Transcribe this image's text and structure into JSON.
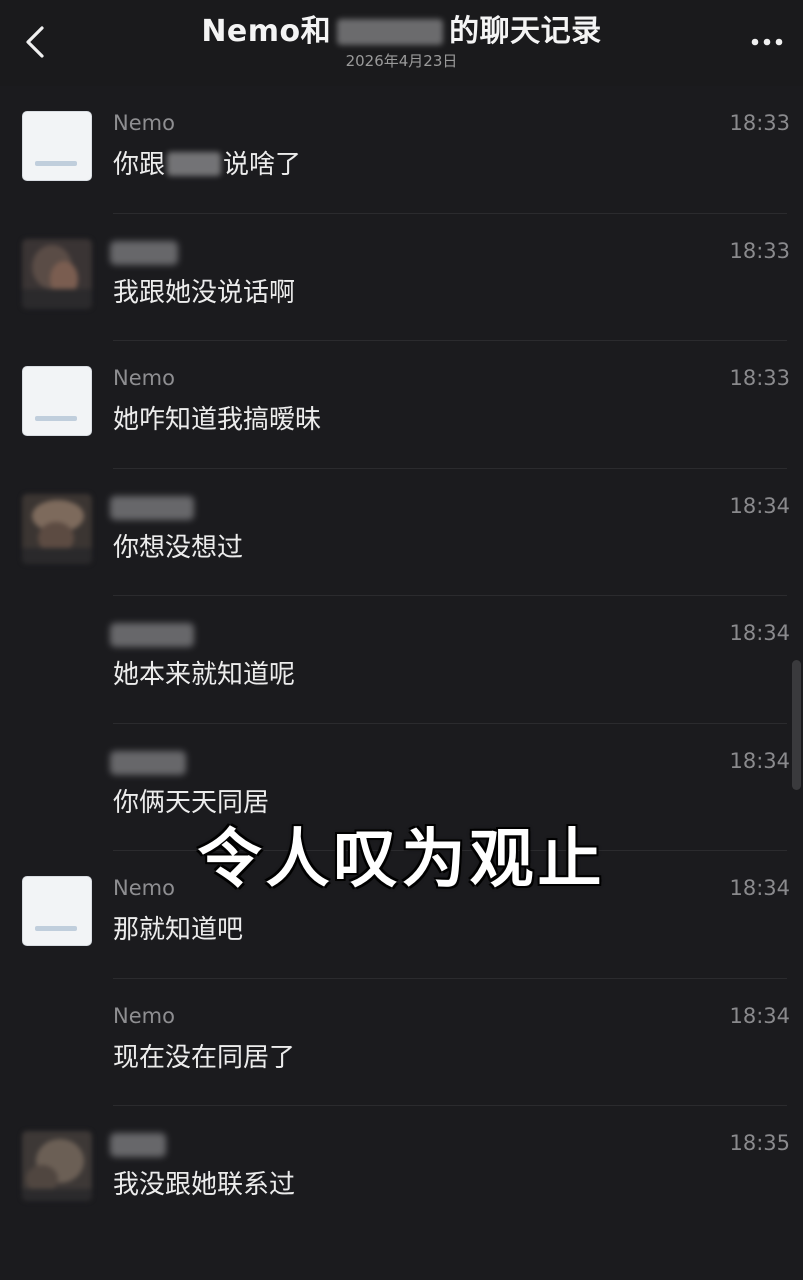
{
  "header": {
    "title_prefix": "Nemo和",
    "title_suffix": "的聊天记录",
    "subtitle": "2026年4月23日",
    "back_icon": "chevron-left-icon",
    "more_icon": "more-horizontal-icon"
  },
  "messages": [
    {
      "sender": "Nemo",
      "time": "18:33",
      "text_before": "你跟",
      "text_after": "说啥了",
      "avatar": "nemo"
    },
    {
      "sender": "",
      "time": "18:33",
      "text": "我跟她没说话啊",
      "avatar": "photo"
    },
    {
      "sender": "Nemo",
      "time": "18:33",
      "text": "她咋知道我搞暧昧",
      "avatar": "nemo"
    },
    {
      "sender": "",
      "time": "18:34",
      "text": "你想没想过",
      "avatar": "photo"
    },
    {
      "sender": "",
      "time": "18:34",
      "text": "她本来就知道呢",
      "avatar": "none"
    },
    {
      "sender": "",
      "time": "18:34",
      "text": "你俩天天同居",
      "avatar": "none"
    },
    {
      "sender": "Nemo",
      "time": "18:34",
      "text": "那就知道吧",
      "avatar": "nemo"
    },
    {
      "sender": "Nemo",
      "time": "18:34",
      "text": "现在没在同居了",
      "avatar": "none"
    },
    {
      "sender": "",
      "time": "18:35",
      "text": "我没跟她联系过",
      "avatar": "photo"
    }
  ],
  "overlay": {
    "caption": "令人叹为观止"
  },
  "colors": {
    "background": "#1b1b1e",
    "text": "#ececec",
    "meta": "#8a8a8d"
  }
}
